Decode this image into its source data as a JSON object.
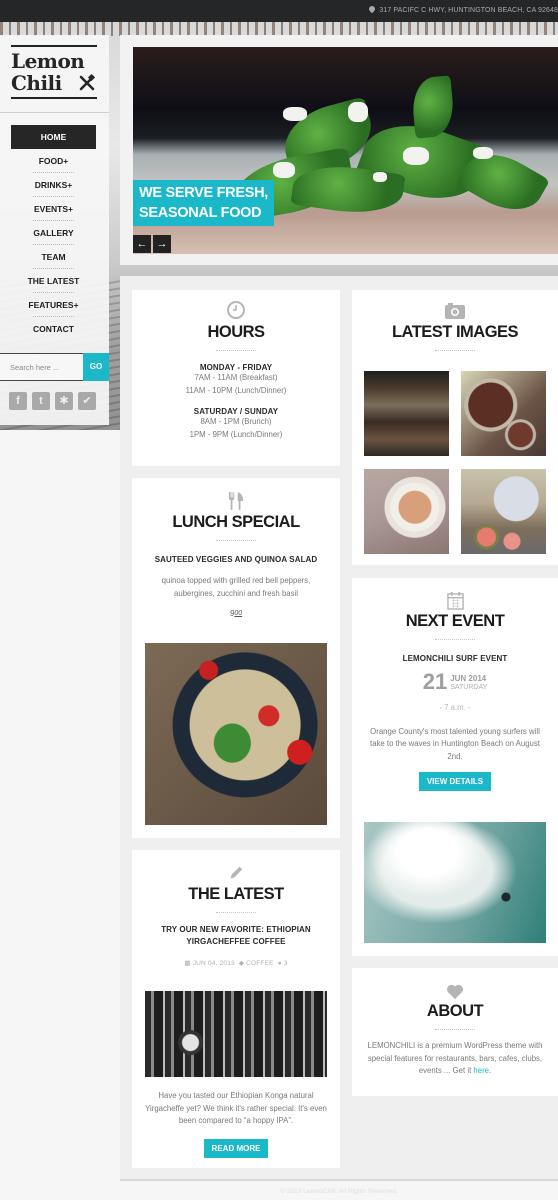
{
  "topbar": {
    "address": "317 PACIFC C HWY, HUNTINGTON BEACH, CA 92648",
    "address_icon": "map-pin-icon"
  },
  "logo": {
    "line1": "Lemon",
    "line2": "Chili",
    "icon": "fork-knife-crossed-icon"
  },
  "nav": {
    "items": [
      {
        "label": "HOME",
        "active": true
      },
      {
        "label": "FOOD+"
      },
      {
        "label": "DRINKS+"
      },
      {
        "label": "EVENTS+"
      },
      {
        "label": "GALLERY"
      },
      {
        "label": "TEAM"
      },
      {
        "label": "THE LATEST"
      },
      {
        "label": "FEATURES+"
      },
      {
        "label": "CONTACT"
      }
    ]
  },
  "search": {
    "placeholder": "Search here ...",
    "button": "GO"
  },
  "social": [
    {
      "name": "facebook-icon",
      "glyph": "f"
    },
    {
      "name": "twitter-icon",
      "glyph": "t"
    },
    {
      "name": "yelp-icon",
      "glyph": "✱"
    },
    {
      "name": "foursquare-icon",
      "glyph": "✔"
    }
  ],
  "slider": {
    "caption_line1": "WE SERVE FRESH,",
    "caption_line2": "SEASONAL FOOD",
    "prev": "←",
    "next": "→"
  },
  "hours": {
    "icon": "clock-icon",
    "title": "HOURS",
    "groups": [
      {
        "days": "MONDAY - FRIDAY",
        "lines": [
          "7AM - 11AM (Breakfast)",
          "11AM - 10PM (Lunch/Dinner)"
        ]
      },
      {
        "days": "SATURDAY / SUNDAY",
        "lines": [
          "8AM - 1PM (Brunch)",
          "1PM - 9PM (Lunch/Dinner)"
        ]
      }
    ]
  },
  "latest_images": {
    "icon": "camera-icon",
    "title": "LATEST IMAGES",
    "images": [
      "coffee-bean-jars",
      "ground-coffee-tins",
      "latte-art-cup",
      "cheese-and-figs"
    ]
  },
  "lunch_special": {
    "icon": "fork-knife-icon",
    "title": "LUNCH SPECIAL",
    "dish": "SAUTEED VEGGIES AND QUINOA SALAD",
    "description_line1": "quinoa topped with grilled red bell peppers,",
    "description_line2": "aubergines, zucchini and fresh basil",
    "price_main": "9",
    "price_cents": "00"
  },
  "next_event": {
    "icon": "calendar-icon",
    "title": "NEXT EVENT",
    "event_name": "LEMONCHILI SURF EVENT",
    "day": "21",
    "month_year": "JUN 2014",
    "weekday": "SATURDAY",
    "time": "- 7 a.m. -",
    "description": "Orange County's most talented young surfers will take to the waves in Huntington Beach on August 2nd.",
    "button": "VIEW DETAILS"
  },
  "the_latest": {
    "icon": "pencil-icon",
    "title": "THE LATEST",
    "post_title_line1": "TRY OUR NEW FAVORITE: ETHIOPIAN",
    "post_title_line2": "YIRGACHEFFEE COFFEE",
    "date": "JUN 04, 2013",
    "category": "COFFEE",
    "comments": "3",
    "excerpt": "Have you tasted our Ethiopian Konga natural Yirgacheffe yet? We think it's rather special. It's even been compared to “a hoppy IPA”.",
    "button": "READ MORE"
  },
  "about": {
    "icon": "heart-icon",
    "title": "ABOUT",
    "text": "LEMONCHILI is a premium WordPress theme with special features for restaurants, bars, cafes, clubs, events ... Get it ",
    "link": "here",
    "after_link": "."
  },
  "footer": {
    "copyright": "© 2013 LemonChili. All Rights Reserved."
  },
  "colors": {
    "accent": "#1ab8c8",
    "dark": "#252628",
    "heading": "#1c1c1c",
    "muted": "#7a7a7a"
  }
}
